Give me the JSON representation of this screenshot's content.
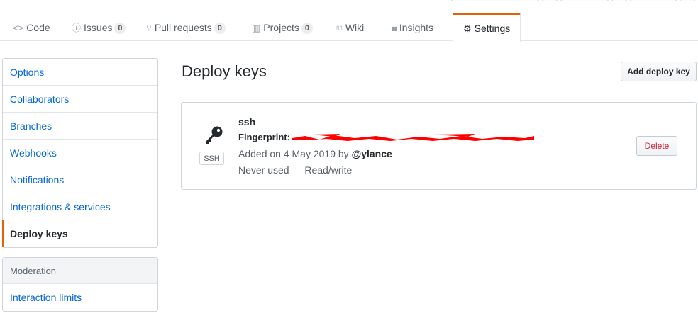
{
  "tabs": [
    {
      "label": "Code",
      "icon": "code-icon",
      "glyph": "<>"
    },
    {
      "label": "Issues",
      "icon": "issue-icon",
      "glyph": "ⓘ",
      "count": "0"
    },
    {
      "label": "Pull requests",
      "icon": "pull-request-icon",
      "glyph": "⑂",
      "count": "0"
    },
    {
      "label": "Projects",
      "icon": "project-icon",
      "glyph": "▥",
      "count": "0"
    },
    {
      "label": "Wiki",
      "icon": "book-icon",
      "glyph": "▯▯"
    },
    {
      "label": "Insights",
      "icon": "graph-icon",
      "glyph": "▮▮"
    },
    {
      "label": "Settings",
      "icon": "gear-icon",
      "glyph": "⚙",
      "selected": true
    }
  ],
  "sidebar": {
    "items": [
      {
        "label": "Options"
      },
      {
        "label": "Collaborators"
      },
      {
        "label": "Branches"
      },
      {
        "label": "Webhooks"
      },
      {
        "label": "Notifications"
      },
      {
        "label": "Integrations & services"
      },
      {
        "label": "Deploy keys",
        "selected": true
      }
    ],
    "moderation": {
      "heading": "Moderation",
      "items": [
        {
          "label": "Interaction limits"
        }
      ]
    }
  },
  "main": {
    "title": "Deploy keys",
    "add_button": "Add deploy key",
    "key": {
      "title": "ssh",
      "fingerprint_label": "Fingerprint:",
      "added_prefix": "Added on 4 May 2019 by",
      "added_by": "@ylance",
      "usage": "Never used — Read/write",
      "type_label": "SSH",
      "delete_button": "Delete"
    }
  },
  "colors": {
    "accent": "#e36209",
    "link": "#0366d6",
    "danger": "#cb2431",
    "redaction": "#ff0000"
  }
}
